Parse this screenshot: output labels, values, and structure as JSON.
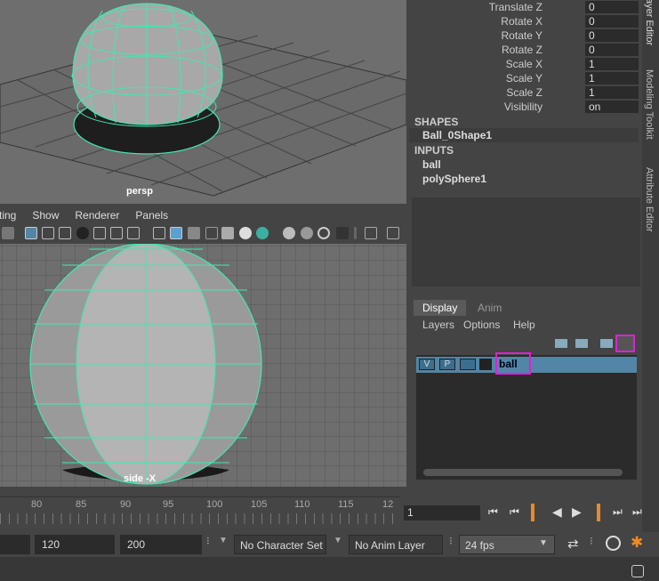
{
  "viewports": {
    "top_camera": "persp",
    "bottom_camera": "side -X"
  },
  "panel_menu": [
    "ting",
    "Show",
    "Renderer",
    "Panels"
  ],
  "channel_box": {
    "rows": [
      {
        "label": "Translate Z",
        "value": "0"
      },
      {
        "label": "Rotate X",
        "value": "0"
      },
      {
        "label": "Rotate Y",
        "value": "0"
      },
      {
        "label": "Rotate Z",
        "value": "0"
      },
      {
        "label": "Scale X",
        "value": "1"
      },
      {
        "label": "Scale Y",
        "value": "1"
      },
      {
        "label": "Scale Z",
        "value": "1"
      },
      {
        "label": "Visibility",
        "value": "on"
      }
    ],
    "shapes_header": "SHAPES",
    "shape_item": "Ball_0Shape1",
    "inputs_header": "INPUTS",
    "input_items": [
      "ball",
      "polySphere1"
    ]
  },
  "layer_editor": {
    "tabs": [
      "Display",
      "Anim"
    ],
    "menu": [
      "Layers",
      "Options",
      "Help"
    ],
    "layer": {
      "v": "V",
      "p": "P",
      "name": "ball"
    }
  },
  "side_tabs": [
    "ayer Editor",
    "Modeling Toolkit",
    "Attribute Editor"
  ],
  "timeline": {
    "ticks": [
      "80",
      "85",
      "90",
      "95",
      "100",
      "105",
      "110",
      "115",
      "12"
    ],
    "current_frame": "1"
  },
  "range": {
    "end_a": "120",
    "end_b": "200",
    "character_set": "No Character Set",
    "anim_layer": "No Anim Layer",
    "fps": "24 fps"
  },
  "colors": {
    "wire": "#45e6b0",
    "highlight": "#e21ed8",
    "layer_row": "#5285a6"
  }
}
